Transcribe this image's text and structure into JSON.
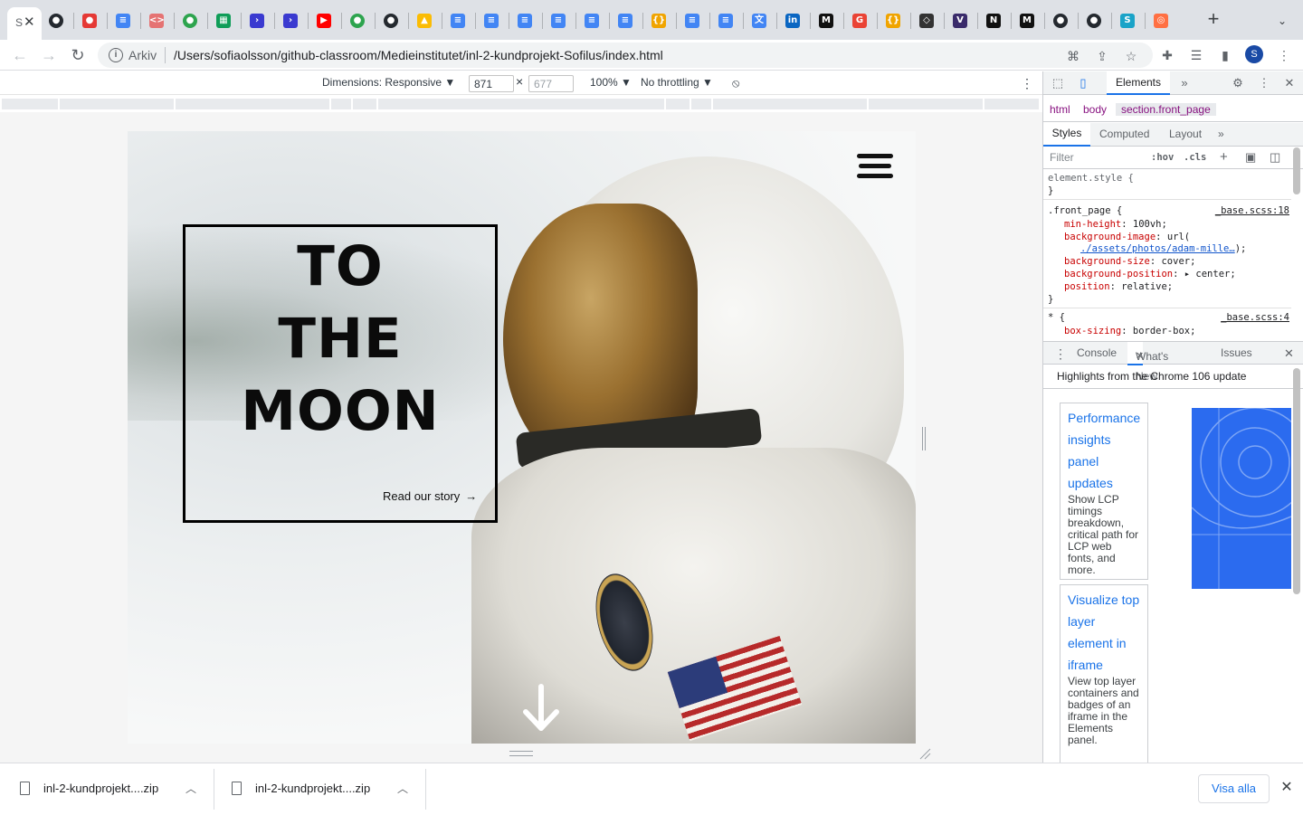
{
  "browser": {
    "active_tab_title": "S",
    "active_tab_close": "✕",
    "tabs": [
      {
        "icon": "github-icon"
      },
      {
        "icon": "pin-icon"
      },
      {
        "icon": "docs-icon"
      },
      {
        "icon": "code-icon"
      },
      {
        "icon": "github-green-icon"
      },
      {
        "icon": "sheets-icon"
      },
      {
        "icon": "powershell-icon"
      },
      {
        "icon": "powershell-icon"
      },
      {
        "icon": "youtube-icon"
      },
      {
        "icon": "github-green-icon"
      },
      {
        "icon": "github-icon"
      },
      {
        "icon": "drive-icon"
      },
      {
        "icon": "docs-icon"
      },
      {
        "icon": "docs-icon"
      },
      {
        "icon": "docs-icon"
      },
      {
        "icon": "docs-icon"
      },
      {
        "icon": "docs-icon"
      },
      {
        "icon": "docs-icon"
      },
      {
        "icon": "json-icon"
      },
      {
        "icon": "docs-icon"
      },
      {
        "icon": "docs-icon"
      },
      {
        "icon": "translate-icon"
      },
      {
        "icon": "linkedin-icon"
      },
      {
        "icon": "medium-icon"
      },
      {
        "icon": "google-icon"
      },
      {
        "icon": "json-icon"
      },
      {
        "icon": "eraser-icon"
      },
      {
        "icon": "vue-icon"
      },
      {
        "icon": "notion-icon"
      },
      {
        "icon": "medium-icon"
      },
      {
        "icon": "github-icon"
      },
      {
        "icon": "github-icon"
      },
      {
        "icon": "s-icon"
      },
      {
        "icon": "orange-icon"
      }
    ],
    "new_tab_label": "+",
    "tab_search_label": "⌄",
    "omnibox": {
      "security_label": "Arkiv",
      "url": "/Users/sofiaolsson/github-classroom/Medieinstitutet/inl-2-kundprojekt-Sofilus/index.html"
    },
    "profile_initial": "S"
  },
  "device_toolbar": {
    "dimensions_label": "Dimensions: Responsive ▼",
    "width_value": "871",
    "times": "×",
    "height_placeholder": "677",
    "zoom_label": "100% ▼",
    "throttling_label": "No throttling ▼"
  },
  "page": {
    "hero_title_lines": [
      "TO",
      "THE",
      "MOON"
    ],
    "read_story_label": "Read our story",
    "read_story_arrow": "→"
  },
  "devtools": {
    "main_tab": "Elements",
    "more_tabs": "»",
    "breadcrumbs": [
      "html",
      "body",
      "section.front_page"
    ],
    "subtabs": [
      "Styles",
      "Computed",
      "Layout",
      "»"
    ],
    "filter_placeholder": "Filter",
    "filter_hov": ":hov",
    "filter_cls": ".cls",
    "code": {
      "element_style": "element.style {",
      "close_brace": "}",
      "front_page_selector": ".front_page {",
      "front_page_source": "_base.scss:18",
      "props": [
        {
          "name": "min-height",
          "value": "100vh;"
        },
        {
          "name": "background-image",
          "value": "url("
        },
        {
          "name": "background-size",
          "value": "cover;"
        },
        {
          "name": "background-position",
          "value": "▸ center;"
        },
        {
          "name": "position",
          "value": "relative;"
        }
      ],
      "bg_url": "./assets/photos/adam-mille…",
      "bg_url_tail": ");",
      "star_selector": "* {",
      "star_source": "_base.scss:4",
      "box_sizing_name": "box-sizing",
      "box_sizing_value": "border-box;"
    },
    "drawer_tabs": [
      "Console",
      "What's New",
      "Issues"
    ],
    "highlights": "Highlights from the Chrome 106 update",
    "cards": [
      {
        "title": "Performance insights panel updates",
        "desc": "Show LCP timings breakdown, critical path for LCP web fonts, and more."
      },
      {
        "title": "Visualize top layer element in iframe",
        "desc": "View top layer containers and badges of an iframe in the Elements panel."
      }
    ]
  },
  "downloads": {
    "items": [
      {
        "name": "inl-2-kundprojekt....zip"
      },
      {
        "name": "inl-2-kundprojekt....zip"
      }
    ],
    "show_all_label": "Visa alla",
    "close_label": "✕"
  },
  "colors": {
    "accent": "#1a73e8",
    "css_property": "#c80000",
    "tabstrip": "#dee1e6"
  }
}
